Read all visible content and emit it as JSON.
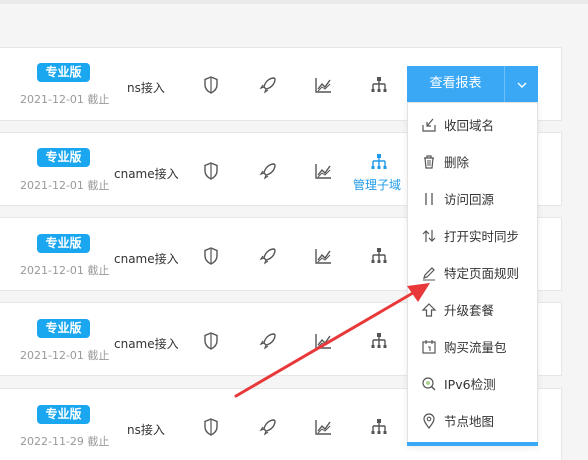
{
  "rows": [
    {
      "edition": "专业版",
      "expiry": "2021-12-01 截止",
      "access": "ns接入"
    },
    {
      "edition": "专业版",
      "expiry": "2021-12-01 截止",
      "access": "cname接入",
      "manage_link": "管理子域"
    },
    {
      "edition": "专业版",
      "expiry": "2021-12-01 截止",
      "access": "cname接入"
    },
    {
      "edition": "专业版",
      "expiry": "2021-12-01 截止",
      "access": "cname接入"
    },
    {
      "edition": "专业版",
      "expiry": "2022-11-29 截止",
      "access": "ns接入"
    }
  ],
  "report_button": {
    "label": "查看报表"
  },
  "dropdown_menu": [
    {
      "label": "收回域名",
      "icon": "reclaim-icon"
    },
    {
      "label": "删除",
      "icon": "trash-icon"
    },
    {
      "label": "访问回源",
      "icon": "origin-icon"
    },
    {
      "label": "打开实时同步",
      "icon": "sync-icon"
    },
    {
      "label": "特定页面规则",
      "icon": "pencil-icon"
    },
    {
      "label": "升级套餐",
      "icon": "upgrade-icon"
    },
    {
      "label": "购买流量包",
      "icon": "calendar-icon"
    },
    {
      "label": "IPv6检测",
      "icon": "search-icon"
    },
    {
      "label": "节点地图",
      "icon": "map-pin-icon"
    }
  ],
  "colors": {
    "badge": "#1aa7f0",
    "button": "#3aa8f5",
    "link": "#1e9be8",
    "arrow": "#e8383a"
  }
}
